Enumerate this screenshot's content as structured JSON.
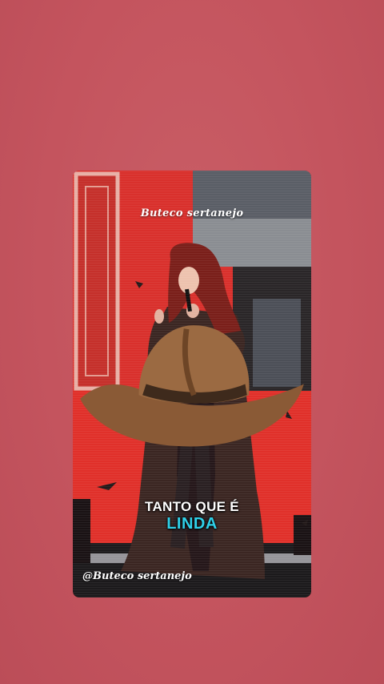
{
  "background_color": "#c4545e",
  "video": {
    "watermark_top": "Buteco sertanejo",
    "lyric_line1": "TANTO QUE É",
    "lyric_line2": "LINDA",
    "lyric_highlight_color": "#2fd0e8",
    "watermark_bottom": "@Buteco sertanejo",
    "hat_icon": "cowboy-hat-icon"
  }
}
